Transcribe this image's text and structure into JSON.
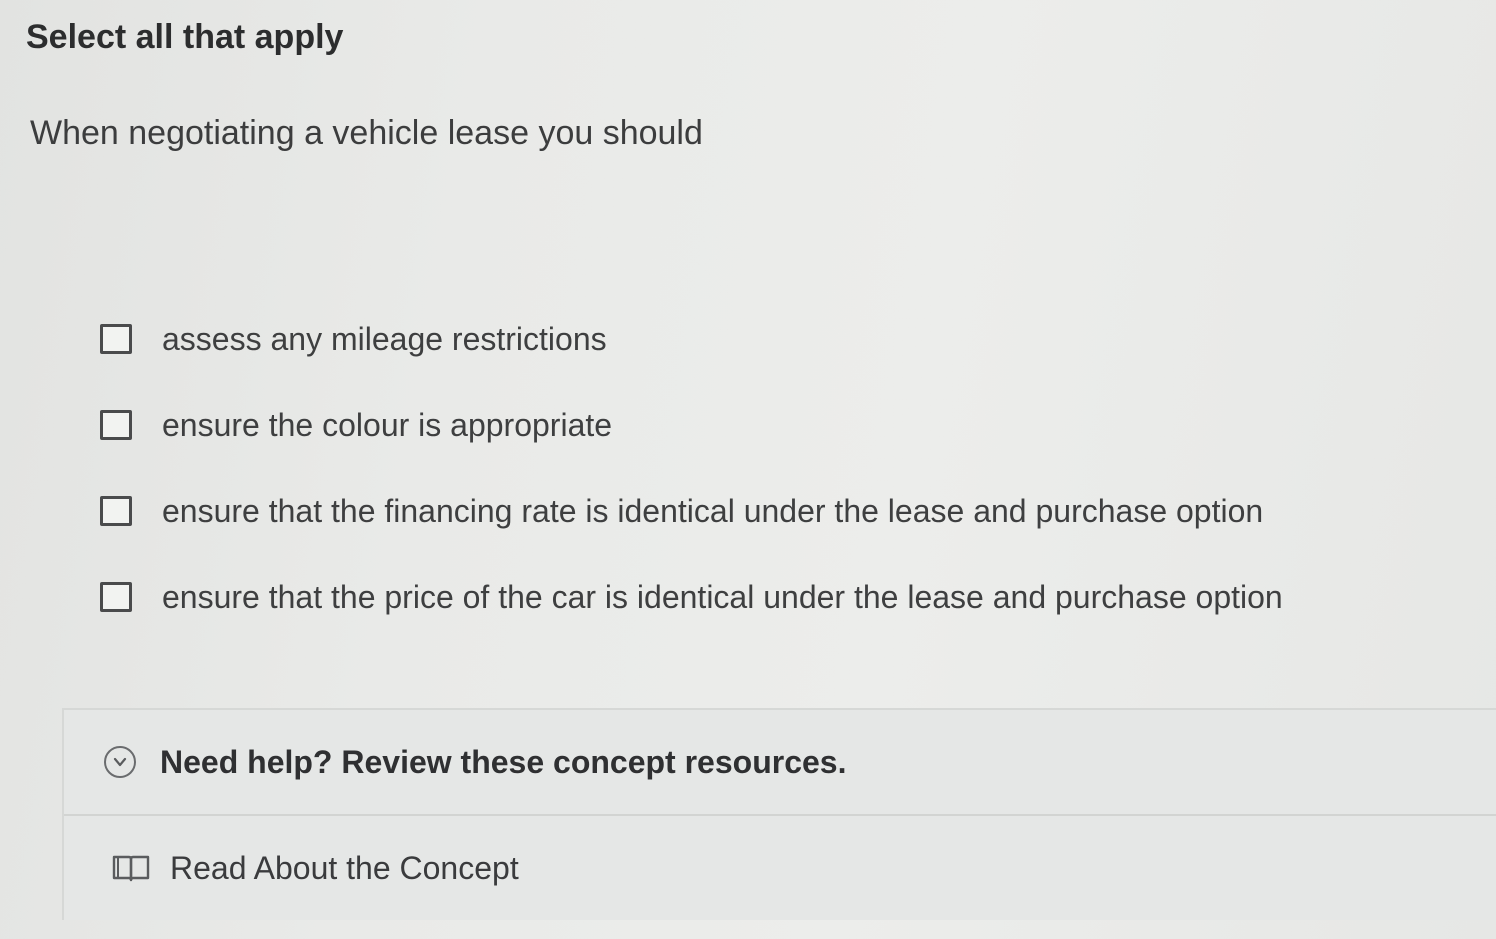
{
  "instruction": "Select all that apply",
  "question": "When negotiating a vehicle lease you should",
  "options": [
    {
      "label": "assess any mileage restrictions",
      "checked": false
    },
    {
      "label": "ensure the colour is appropriate",
      "checked": false
    },
    {
      "label": "ensure that the financing rate is identical under the lease and purchase option",
      "checked": false
    },
    {
      "label": "ensure that the price of the car is identical under the lease and purchase option",
      "checked": false
    }
  ],
  "help": {
    "title": "Need help? Review these concept resources.",
    "toggle_icon": "chevron-down-circle-icon",
    "resources": [
      {
        "label": "Read About the Concept",
        "icon": "book-icon"
      }
    ]
  }
}
